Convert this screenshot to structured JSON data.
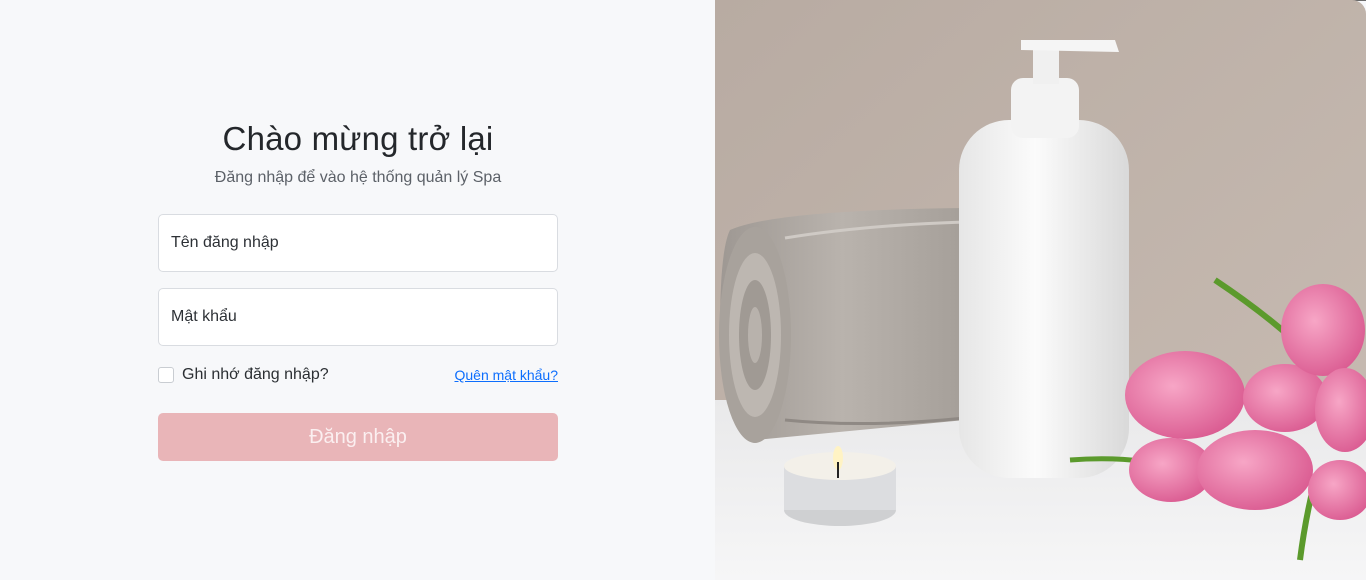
{
  "login": {
    "title": "Chào mừng trở lại",
    "subtitle": "Đăng nhập để vào hệ thống quản lý Spa",
    "username_placeholder": "Tên đăng nhập",
    "username_value": "",
    "password_placeholder": "Mật khẩu",
    "password_value": "",
    "remember_label": "Ghi nhớ đăng nhập?",
    "remember_checked": false,
    "forgot_link": "Quên mật khẩu?",
    "submit_label": "Đăng nhập"
  },
  "colors": {
    "background": "#f7f8fa",
    "submit_button": "#e9b5b8",
    "link": "#0d6efd"
  },
  "hero_image": {
    "subject": "spa-products-photo"
  }
}
